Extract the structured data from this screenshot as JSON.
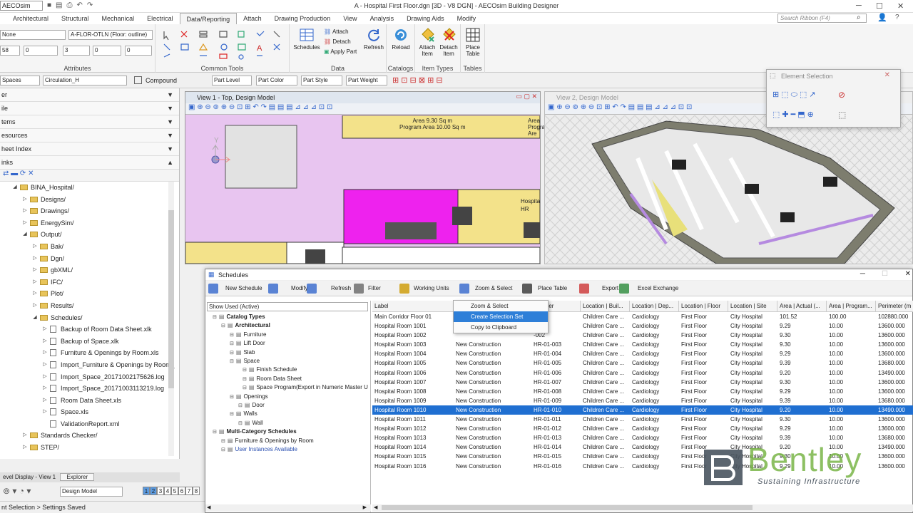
{
  "app": {
    "workspace": "AECOsim",
    "title": "A - Hospital First Floor.dgn [3D - V8 DGN] - AECOsim Building Designer"
  },
  "ribbon": {
    "tabs": [
      "Architectural",
      "Structural",
      "Mechanical",
      "Electrical",
      "Data/Reporting",
      "Attach",
      "Drawing Production",
      "View",
      "Analysis",
      "Drawing Aids",
      "Modify"
    ],
    "active_tab": "Data/Reporting",
    "search_placeholder": "Search Ribbon (F4)",
    "attributes": {
      "level_combo": "None",
      "element_template": "A-FLOR-OTLN (Floor: outline)",
      "val1": "58",
      "val2": "0",
      "val3": "3",
      "val4": "0",
      "val5": "0",
      "label": "Attributes"
    },
    "common_tools_label": "Common Tools",
    "data": {
      "schedules": "Schedules",
      "attach": "Attach",
      "detach": "Detach",
      "apply_part": "Apply Part",
      "refresh": "Refresh",
      "label": "Data"
    },
    "catalogs": {
      "reload": "Reload",
      "label": "Catalogs"
    },
    "item_types": {
      "attach_item": "Attach Item",
      "detach_item": "Detach Item",
      "label": "Item Types"
    },
    "tables": {
      "place_table": "Place Table",
      "label": "Tables"
    }
  },
  "toolbar2": {
    "spaces": "Spaces",
    "circulation": "Circulation_H",
    "compound": "Compound",
    "part_level": "Part Level",
    "part_color": "Part Color",
    "part_style": "Part Style",
    "part_weight": "Part Weight"
  },
  "explorer": {
    "rows": [
      "er",
      "ile",
      "tems",
      "esources",
      "heet Index",
      "inks"
    ],
    "tree": [
      {
        "label": "BINA_Hospital/",
        "indent": 1,
        "arrow": "◢"
      },
      {
        "label": "Designs/",
        "indent": 2,
        "arrow": "▷"
      },
      {
        "label": "Drawings/",
        "indent": 2,
        "arrow": "▷"
      },
      {
        "label": "EnergySim/",
        "indent": 2,
        "arrow": "▷"
      },
      {
        "label": "Output/",
        "indent": 2,
        "arrow": "◢"
      },
      {
        "label": "Bak/",
        "indent": 3,
        "arrow": "▷"
      },
      {
        "label": "Dgn/",
        "indent": 3,
        "arrow": "▷"
      },
      {
        "label": "gbXML/",
        "indent": 3,
        "arrow": "▷"
      },
      {
        "label": "IFC/",
        "indent": 3,
        "arrow": "▷"
      },
      {
        "label": "Plot/",
        "indent": 3,
        "arrow": "▷"
      },
      {
        "label": "Results/",
        "indent": 3,
        "arrow": "▷"
      },
      {
        "label": "Schedules/",
        "indent": 3,
        "arrow": "◢"
      },
      {
        "label": "Backup of Room Data Sheet.xlk",
        "indent": 4,
        "arrow": "▷",
        "file": true
      },
      {
        "label": "Backup of Space.xlk",
        "indent": 4,
        "arrow": "▷",
        "file": true
      },
      {
        "label": "Furniture & Openings by Room.xls",
        "indent": 4,
        "arrow": "▷",
        "file": true
      },
      {
        "label": "Import_Furniture & Openings by Room_",
        "indent": 4,
        "arrow": "▷",
        "file": true
      },
      {
        "label": "Import_Space_20171002175626.log",
        "indent": 4,
        "arrow": "▷",
        "file": true
      },
      {
        "label": "Import_Space_20171003113219.log",
        "indent": 4,
        "arrow": "▷",
        "file": true
      },
      {
        "label": "Room Data Sheet.xls",
        "indent": 4,
        "arrow": "▷",
        "file": true
      },
      {
        "label": "Space.xls",
        "indent": 4,
        "arrow": "▷",
        "file": true
      },
      {
        "label": "ValidationReport.xml",
        "indent": 4,
        "arrow": "",
        "file": true
      },
      {
        "label": "Standards Checker/",
        "indent": 2,
        "arrow": "▷"
      },
      {
        "label": "STEP/",
        "indent": 2,
        "arrow": "▷"
      }
    ],
    "bottom_tabs": [
      "evel Display - View 1",
      "Explorer"
    ],
    "design_model": "Design Model",
    "view_numbers": [
      "1",
      "2",
      "3",
      "4",
      "5",
      "6",
      "7",
      "8"
    ]
  },
  "views": {
    "view1_title": "View 1 - Top, Design Model",
    "view2_title": "View 2, Design Model",
    "room_label1": "Area 9.30 Sq m",
    "room_label2": "Program Area 10.00 Sq m",
    "room_label3": "Area",
    "room_label4": "Program Are",
    "room_label5": "Hospita",
    "room_label6": "HR"
  },
  "element_selection": {
    "title": "Element Selection"
  },
  "schedules": {
    "title": "Schedules",
    "toolbar": [
      "New Schedule",
      "Modify",
      "Refresh",
      "Filter",
      "Working Units",
      "Zoom & Select",
      "Place Table",
      "Export",
      "Excel Exchange"
    ],
    "filter_combo": "Show Used (Active)",
    "tree": [
      {
        "label": "Catalog Types",
        "bold": true
      },
      {
        "label": "Architectural",
        "bold": true
      },
      {
        "label": "Furniture"
      },
      {
        "label": "Lift Door"
      },
      {
        "label": "Slab"
      },
      {
        "label": "Space"
      },
      {
        "label": "Finish Schedule"
      },
      {
        "label": "Room Data Sheet"
      },
      {
        "label": "Space Program(Export in Numeric Master U"
      },
      {
        "label": "Openings"
      },
      {
        "label": "Door"
      },
      {
        "label": "Walls"
      },
      {
        "label": "Wall"
      },
      {
        "label": "Multi-Category Schedules",
        "bold": true
      },
      {
        "label": "Furniture & Openings by Room"
      },
      {
        "label": "User Instances Available",
        "link": true
      }
    ],
    "columns": [
      "Label",
      "",
      "Number",
      "Location | Buil...",
      "Location | Dep...",
      "Location | Floor",
      "Location | Site",
      "Area | Actual (...",
      "Area | Program...",
      "Perimeter (m"
    ],
    "rows": [
      [
        "Main Corridor Floor 01",
        "",
        "-001",
        "Children Care ...",
        "Cardiology",
        "First Floor",
        "City Hospital",
        "101.52",
        "100.00",
        "102880.000"
      ],
      [
        "Hospital Room 1001",
        "",
        "-001",
        "Children Care ...",
        "Cardiology",
        "First Floor",
        "City Hospital",
        "9.29",
        "10.00",
        "13600.000"
      ],
      [
        "Hospital Room 1002",
        "",
        "-002",
        "Children Care ...",
        "Cardiology",
        "First Floor",
        "City Hospital",
        "9.30",
        "10.00",
        "13600.000"
      ],
      [
        "Hospital Room 1003",
        "New Construction",
        "HR-01-003",
        "Children Care ...",
        "Cardiology",
        "First Floor",
        "City Hospital",
        "9.30",
        "10.00",
        "13600.000"
      ],
      [
        "Hospital Room 1004",
        "New Construction",
        "HR-01-004",
        "Children Care ...",
        "Cardiology",
        "First Floor",
        "City Hospital",
        "9.29",
        "10.00",
        "13600.000"
      ],
      [
        "Hospital Room 1005",
        "New Construction",
        "HR-01-005",
        "Children Care ...",
        "Cardiology",
        "First Floor",
        "City Hospital",
        "9.39",
        "10.00",
        "13680.000"
      ],
      [
        "Hospital Room 1006",
        "New Construction",
        "HR-01-006",
        "Children Care ...",
        "Cardiology",
        "First Floor",
        "City Hospital",
        "9.20",
        "10.00",
        "13490.000"
      ],
      [
        "Hospital Room 1007",
        "New Construction",
        "HR-01-007",
        "Children Care ...",
        "Cardiology",
        "First Floor",
        "City Hospital",
        "9.30",
        "10.00",
        "13600.000"
      ],
      [
        "Hospital Room 1008",
        "New Construction",
        "HR-01-008",
        "Children Care ...",
        "Cardiology",
        "First Floor",
        "City Hospital",
        "9.29",
        "10.00",
        "13600.000"
      ],
      [
        "Hospital Room 1009",
        "New Construction",
        "HR-01-009",
        "Children Care ...",
        "Cardiology",
        "First Floor",
        "City Hospital",
        "9.39",
        "10.00",
        "13680.000"
      ],
      [
        "Hospital Room 1010",
        "New Construction",
        "HR-01-010",
        "Children Care ...",
        "Cardiology",
        "First Floor",
        "City Hospital",
        "9.20",
        "10.00",
        "13490.000"
      ],
      [
        "Hospital Room 1011",
        "New Construction",
        "HR-01-011",
        "Children Care ...",
        "Cardiology",
        "First Floor",
        "City Hospital",
        "9.30",
        "10.00",
        "13600.000"
      ],
      [
        "Hospital Room 1012",
        "New Construction",
        "HR-01-012",
        "Children Care ...",
        "Cardiology",
        "First Floor",
        "City Hospital",
        "9.29",
        "10.00",
        "13600.000"
      ],
      [
        "Hospital Room 1013",
        "New Construction",
        "HR-01-013",
        "Children Care ...",
        "Cardiology",
        "First Floor",
        "City Hospital",
        "9.39",
        "10.00",
        "13680.000"
      ],
      [
        "Hospital Room 1014",
        "New Construction",
        "HR-01-014",
        "Children Care ...",
        "Cardiology",
        "First Floor",
        "City Hospital",
        "9.20",
        "10.00",
        "13490.000"
      ],
      [
        "Hospital Room 1015",
        "New Construction",
        "HR-01-015",
        "Children Care ...",
        "Cardiology",
        "First Floor",
        "City Hospital",
        "9.30",
        "10.00",
        "13600.000"
      ],
      [
        "Hospital Room 1016",
        "New Construction",
        "HR-01-016",
        "Children Care ...",
        "Cardiology",
        "First Floor",
        "City Hospital",
        "9.29",
        "10.00",
        "13600.000"
      ]
    ],
    "selected_row": 10,
    "context_menu": [
      "Zoom & Select",
      "Create Selection Set",
      "Copy to Clipboard"
    ],
    "context_highlight": 1
  },
  "status": {
    "text": "nt Selection > Settings Saved"
  },
  "watermark": {
    "brand": "Bentley",
    "tagline": "Sustaining Infrastructure"
  },
  "colors": {
    "selection": "#1f6fd1",
    "room_magenta": "#ee22ee",
    "room_pink": "#e8c5f0",
    "room_yellow": "#f3e28a",
    "brand_green": "#7ab648"
  }
}
